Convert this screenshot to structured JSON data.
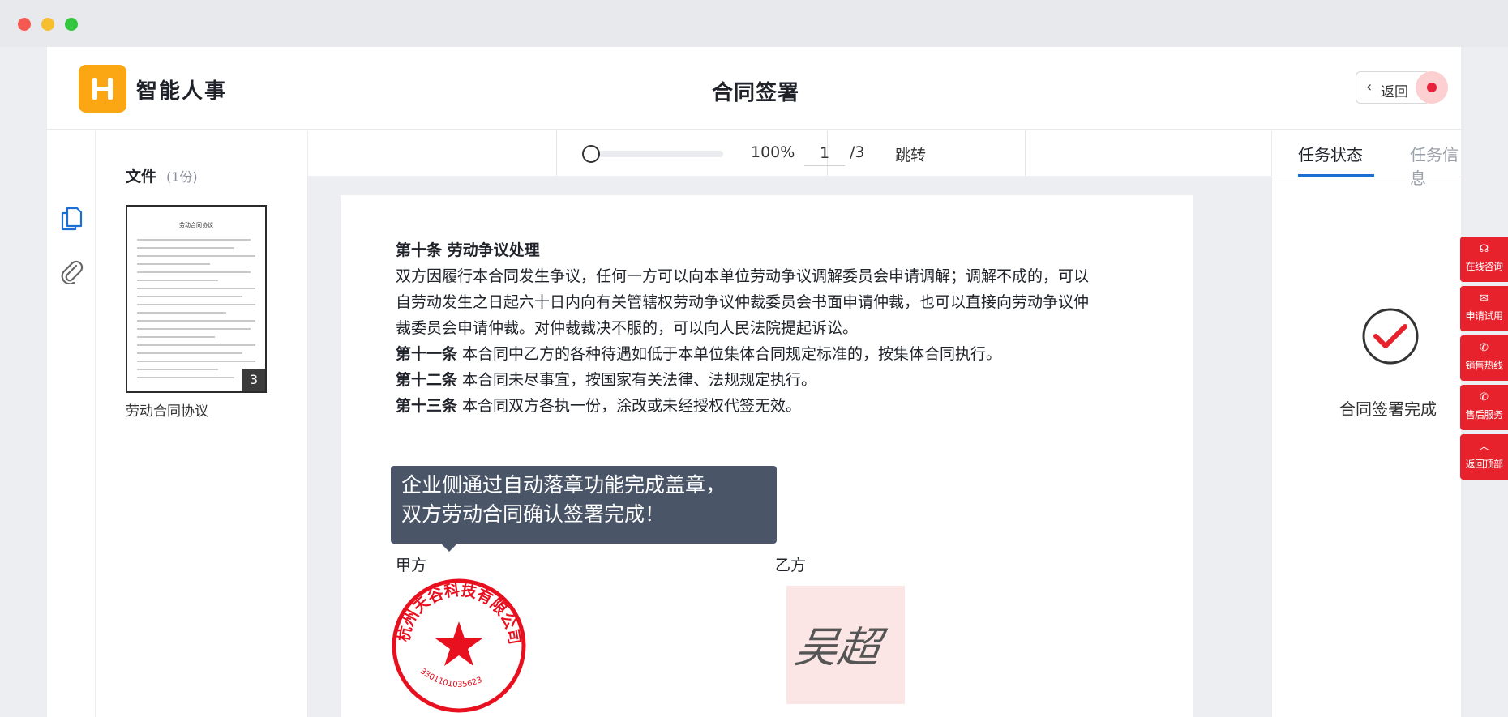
{
  "app": {
    "brand": "智能人事",
    "page_title": "合同签署",
    "back_label": "返回"
  },
  "files": {
    "heading": "文件",
    "count": "(1份)",
    "items": [
      {
        "name": "劳动合同协议",
        "thumb_title": "劳动合同协议",
        "pages": "3"
      }
    ]
  },
  "toolbar": {
    "zoom": "100%",
    "page_current": "1",
    "page_total": "/3",
    "jump_label": "跳转"
  },
  "document": {
    "clause10_title": "第十条 劳动争议处理",
    "clause10_line1": "双方因履行本合同发生争议，任何一方可以向本单位劳动争议调解委员会申请调解；调解不成的，可以",
    "clause10_line2": "自劳动发生之日起六十日内向有关管辖权劳动争议仲裁委员会书面申请仲裁，也可以直接向劳动争议仲",
    "clause10_line3": "裁委员会申请仲裁。对仲裁裁决不服的，可以向人民法院提起诉讼。",
    "clause11_head": "第十一条",
    "clause11_text": " 本合同中乙方的各种待遇如低于本单位集体合同规定标准的，按集体合同执行。",
    "clause12_head": "第十二条",
    "clause12_text": " 本合同未尽事宜，按国家有关法律、法规规定执行。",
    "clause13_head": "第十三条",
    "clause13_text": " 本合同双方各执一份，涂改或未经授权代签无效。",
    "tooltip_line1": "企业侧通过自动落章功能完成盖章，",
    "tooltip_line2": "双方劳动合同确认签署完成！",
    "party_a": "甲方",
    "party_b": "乙方",
    "seal_text": "杭州天谷科技有限公司",
    "seal_number": "3301101035623",
    "signature": "吴超"
  },
  "right_panel": {
    "tabs": [
      {
        "label": "任务状态",
        "active": true
      },
      {
        "label": "任务信息",
        "active": false
      }
    ],
    "status_text": "合同签署完成"
  },
  "float_menu": [
    {
      "label": "在线咨询",
      "icon": "headset-icon"
    },
    {
      "label": "申请试用",
      "icon": "mail-icon"
    },
    {
      "label": "销售热线",
      "icon": "phone-icon"
    },
    {
      "label": "售后服务",
      "icon": "phone-icon"
    },
    {
      "label": "返回顶部",
      "icon": "chevron-up-icon"
    }
  ],
  "colors": {
    "brand_orange": "#fba613",
    "accent_blue": "#1b6fd4",
    "float_red": "#e8222d",
    "seal_red": "#e8101f",
    "tooltip_bg": "#4a5568"
  }
}
